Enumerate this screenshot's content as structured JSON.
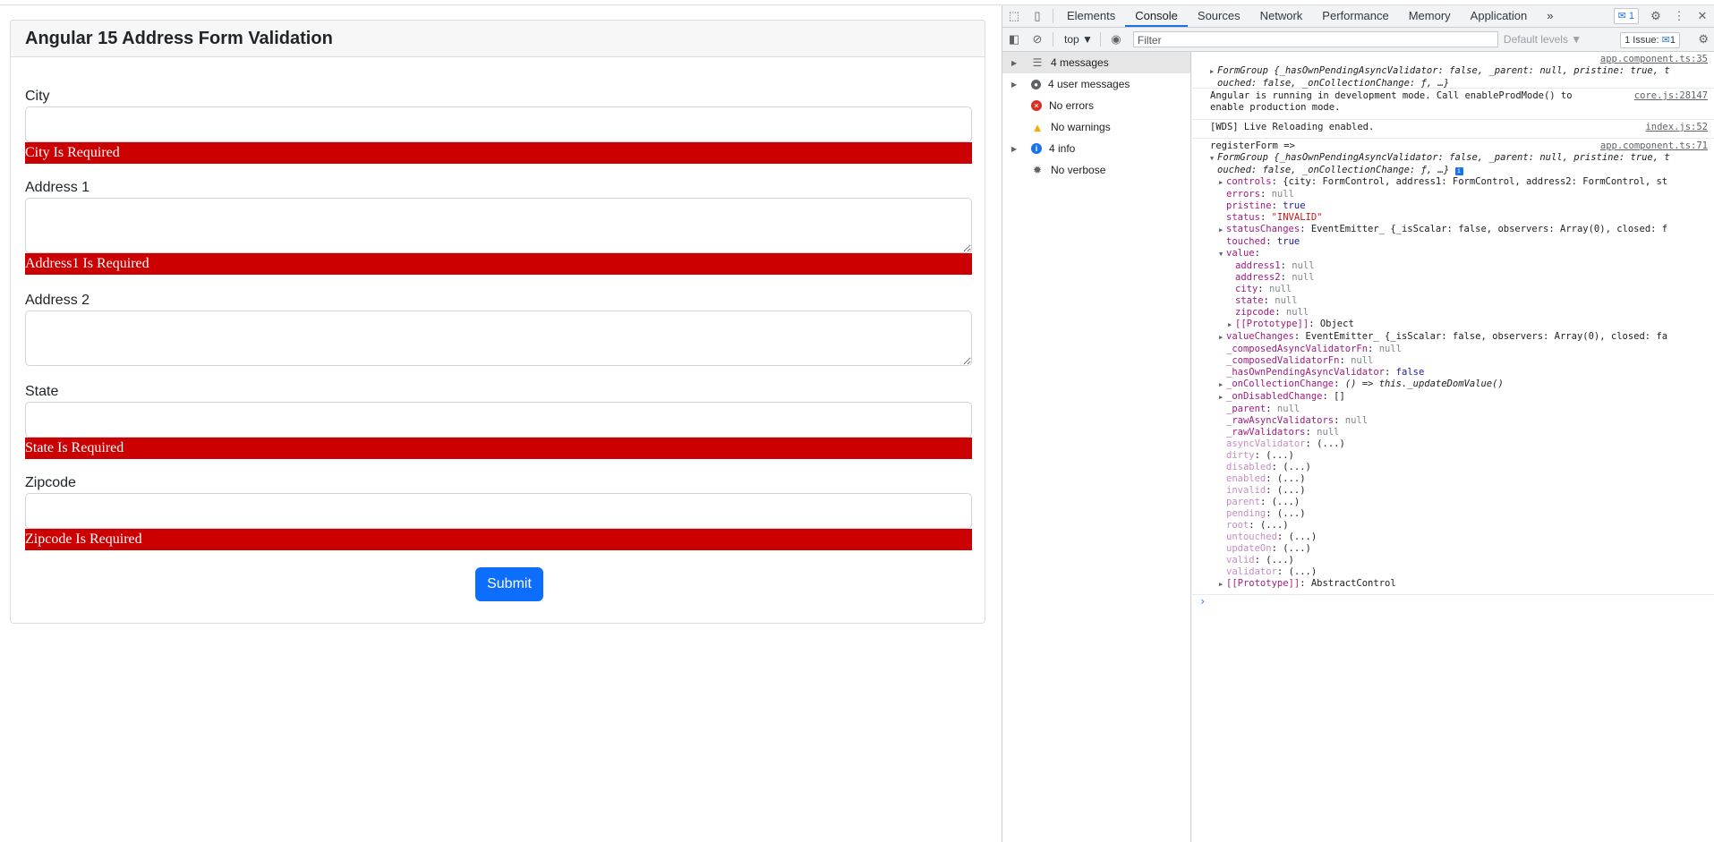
{
  "app": {
    "title": "Angular 15 Address Form Validation",
    "fields": [
      {
        "label": "City",
        "error": "City Is Required"
      },
      {
        "label": "Address 1",
        "error": "Address1 Is Required"
      },
      {
        "label": "Address 2",
        "error": ""
      },
      {
        "label": "State",
        "error": "State Is Required"
      },
      {
        "label": "Zipcode",
        "error": "Zipcode Is Required"
      }
    ],
    "submit_label": "Submit"
  },
  "devtools": {
    "tabs": [
      "Elements",
      "Console",
      "Sources",
      "Network",
      "Performance",
      "Memory",
      "Application"
    ],
    "more": "»",
    "msg_badge": "1",
    "toolbar": {
      "context": "top ▼",
      "filter_placeholder": "Filter",
      "levels": "Default levels ▼",
      "issues": "1 Issue:",
      "issues_count": "1"
    },
    "sidebar": [
      {
        "label": "4 messages",
        "selected": true,
        "icon": "list-icon"
      },
      {
        "label": "4 user messages",
        "icon": "user-icon"
      },
      {
        "label": "No errors",
        "icon": "error-icon"
      },
      {
        "label": "No warnings",
        "icon": "warning-icon"
      },
      {
        "label": "4 info",
        "icon": "info-icon"
      },
      {
        "label": "No verbose",
        "icon": "bug-icon"
      }
    ],
    "console": {
      "m1_src": "app.component.ts:35",
      "m1_text": "FormGroup {_hasOwnPendingAsyncValidator: false, _parent: null, pristine: true, t",
      "m1_text2": "ouched: false, _onCollectionChange: ƒ, …}",
      "m2_text": "Angular is running in development mode. Call enableProdMode() to",
      "m2_text2": "enable production mode.",
      "m2_src": "core.js:28147",
      "m3_text": "[WDS] Live Reloading enabled.",
      "m3_src": "index.js:52",
      "m4_text": "registerForm =>",
      "m4_src": "app.component.ts:71",
      "m4_obj": "FormGroup {_hasOwnPendingAsyncValidator: false, _parent: null, pristine: true, t",
      "m4_obj2": "ouched: false, _onCollectionChange: ƒ, …}",
      "lines": [
        {
          "k": "controls",
          "v": "{city: FormControl, address1: FormControl, address2: FormControl, st"
        },
        {
          "k": "errors",
          "v": "null"
        },
        {
          "k": "pristine",
          "v": "true"
        },
        {
          "k": "status",
          "v": "\"INVALID\""
        },
        {
          "k": "statusChanges",
          "v": "EventEmitter_ {_isScalar: false, observers: Array(0), closed: f"
        },
        {
          "k": "touched",
          "v": "true"
        },
        {
          "k": "value",
          "v": ""
        },
        {
          "k": "address1",
          "v": "null"
        },
        {
          "k": "address2",
          "v": "null"
        },
        {
          "k": "city",
          "v": "null"
        },
        {
          "k": "state",
          "v": "null"
        },
        {
          "k": "zipcode",
          "v": "null"
        },
        {
          "k": "[[Prototype]]",
          "v": "Object"
        },
        {
          "k": "valueChanges",
          "v": "EventEmitter_ {_isScalar: false, observers: Array(0), closed: fa"
        },
        {
          "k": "_composedAsyncValidatorFn",
          "v": "null"
        },
        {
          "k": "_composedValidatorFn",
          "v": "null"
        },
        {
          "k": "_hasOwnPendingAsyncValidator",
          "v": "false"
        },
        {
          "k": "_onCollectionChange",
          "v": "() => this._updateDomValue()"
        },
        {
          "k": "_onDisabledChange",
          "v": "[]"
        },
        {
          "k": "_parent",
          "v": "null"
        },
        {
          "k": "_rawAsyncValidators",
          "v": "null"
        },
        {
          "k": "_rawValidators",
          "v": "null"
        },
        {
          "k": "asyncValidator",
          "v": "(...)"
        },
        {
          "k": "dirty",
          "v": "(...)"
        },
        {
          "k": "disabled",
          "v": "(...)"
        },
        {
          "k": "enabled",
          "v": "(...)"
        },
        {
          "k": "invalid",
          "v": "(...)"
        },
        {
          "k": "parent",
          "v": "(...)"
        },
        {
          "k": "pending",
          "v": "(...)"
        },
        {
          "k": "root",
          "v": "(...)"
        },
        {
          "k": "untouched",
          "v": "(...)"
        },
        {
          "k": "updateOn",
          "v": "(...)"
        },
        {
          "k": "valid",
          "v": "(...)"
        },
        {
          "k": "validator",
          "v": "(...)"
        },
        {
          "k": "[[Prototype]]",
          "v": "AbstractControl"
        }
      ]
    }
  }
}
